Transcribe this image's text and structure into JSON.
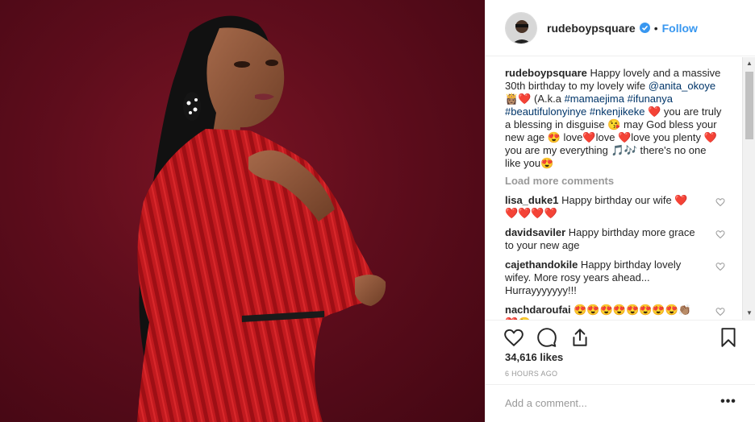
{
  "post": {
    "username": "rudeboypsquare",
    "follow_label": "Follow",
    "separator": "•",
    "caption": {
      "username": "rudeboypsquare",
      "part1": " Happy lovely and a massive 30th birthday to my lovely wife ",
      "mention": "@anita_okoye",
      "part2": " 👸🏽❤️ (A.k.a ",
      "tag1": "#mamaejima",
      "tag2": "#ifunanya",
      "tag3": "#beautifulonyinye",
      "tag4": "#nkenjikeke",
      "part3": " ❤️ you are truly a blessing in disguise 😘 may God bless your new age 😍 love❤️love ❤️love you plenty ❤️you are my everything 🎵🎶 there's no one like you😍"
    },
    "load_more_label": "Load more comments",
    "comments": [
      {
        "username": "lisa_duke1",
        "text": " Happy birthday our wife ❤️❤️❤️❤️❤️"
      },
      {
        "username": "davidsaviler",
        "text": " Happy birthday more grace to your new age"
      },
      {
        "username": "cajethandokile",
        "text": " Happy birthday lovely wifey. More rosy years ahead... Hurrayyyyyyy!!!"
      },
      {
        "username": "nachdaroufai",
        "text": " 😍😍😍😍😍😍😍😍👏🏽❤️😘"
      }
    ],
    "likes": "34,616 likes",
    "time_ago": "6 HOURS AGO",
    "comment_placeholder": "Add a comment...",
    "more_options": "•••"
  },
  "colors": {
    "accent": "#3897f0",
    "hashtag": "#003569",
    "muted": "#999999",
    "background_photo": "#5e0d1c",
    "dress": "#c4161c"
  },
  "icons": {
    "verified": "verified-badge-icon",
    "like": "heart-icon",
    "comment": "comment-bubble-icon",
    "share": "share-icon",
    "save": "bookmark-icon"
  }
}
